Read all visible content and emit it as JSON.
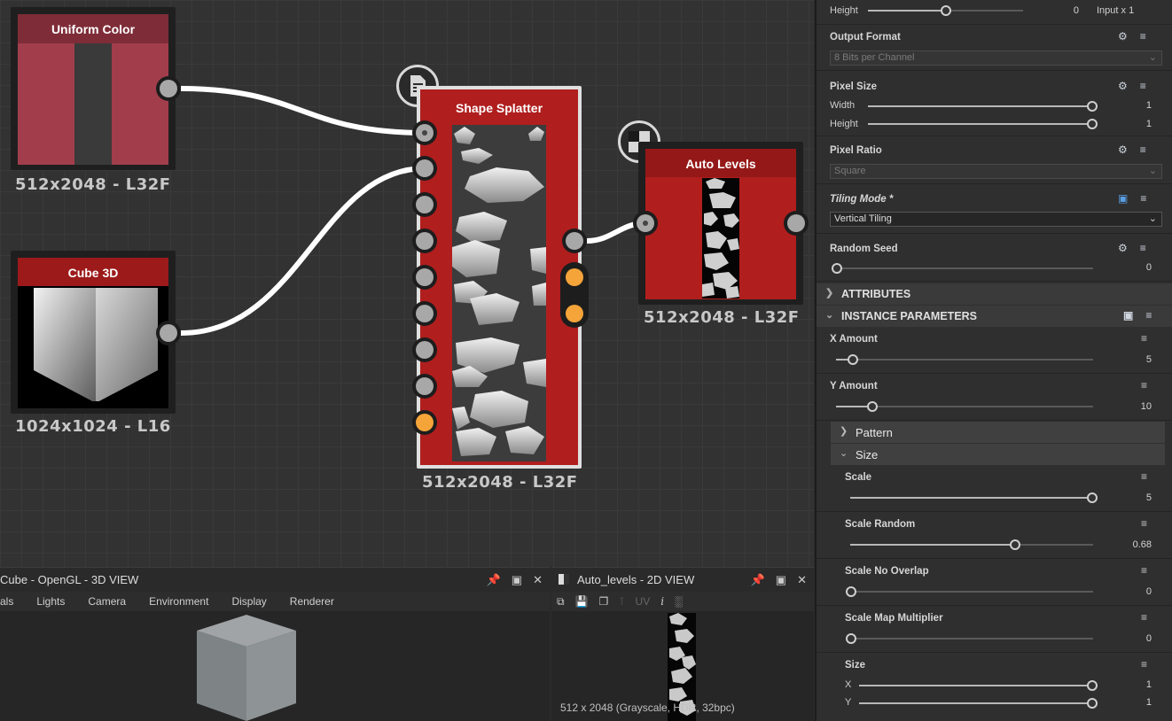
{
  "graph": {
    "nodes": {
      "uniform_color": {
        "title": "Uniform Color",
        "resolution": "512x2048 - L32F",
        "color": "#a23e4c"
      },
      "cube_3d": {
        "title": "Cube 3D",
        "resolution": "1024x1024 - L16"
      },
      "shape_splatter": {
        "title": "Shape Splatter",
        "resolution": "512x2048 - L32F",
        "color": "#b01e1e"
      },
      "auto_levels": {
        "title": "Auto Levels",
        "resolution": "512x2048 - L32F",
        "color": "#b01e1e"
      }
    }
  },
  "view3d": {
    "title": "Cube - OpenGL - 3D VIEW",
    "menu": [
      "als",
      "Lights",
      "Camera",
      "Environment",
      "Display",
      "Renderer"
    ]
  },
  "view2d": {
    "title": "Auto_levels - 2D VIEW",
    "toolbar_uv": "UV",
    "status": "512 x 2048 (Grayscale, HDR, 32bpc)"
  },
  "properties": {
    "height_top": {
      "label": "Height",
      "value": "0",
      "extra": "Input x 1",
      "position": 0.5
    },
    "output_format": {
      "label": "Output Format",
      "value": "8 Bits per Channel"
    },
    "pixel_size": {
      "label": "Pixel Size",
      "width_label": "Width",
      "width_value": "1",
      "height_label": "Height",
      "height_value": "1"
    },
    "pixel_ratio": {
      "label": "Pixel Ratio",
      "value": "Square"
    },
    "tiling_mode": {
      "label": "Tiling Mode *",
      "value": "Vertical Tiling"
    },
    "random_seed": {
      "label": "Random Seed",
      "value": "0"
    },
    "sections": {
      "attributes": "ATTRIBUTES",
      "instance_parameters": "INSTANCE PARAMETERS"
    },
    "x_amount": {
      "label": "X Amount",
      "value": "5",
      "position": 0.065
    },
    "y_amount": {
      "label": "Y Amount",
      "value": "10",
      "position": 0.14
    },
    "pattern": {
      "label": "Pattern"
    },
    "size_group": {
      "label": "Size"
    },
    "scale": {
      "label": "Scale",
      "value": "5",
      "position": 1.0
    },
    "scale_random": {
      "label": "Scale Random",
      "value": "0.68",
      "position": 0.68
    },
    "scale_no_overlap": {
      "label": "Scale No Overlap",
      "value": "0",
      "position": 0
    },
    "scale_map_multiplier": {
      "label": "Scale Map Multiplier",
      "value": "0",
      "position": 0
    },
    "size": {
      "label": "Size",
      "x_label": "X",
      "x_value": "1",
      "y_label": "Y",
      "y_value": "1"
    }
  },
  "colors": {
    "node_red": "#b01e1e",
    "node_pink": "#a23e4c",
    "port_orange": "#f5a43a",
    "panel_bg": "#2f2f2f"
  }
}
